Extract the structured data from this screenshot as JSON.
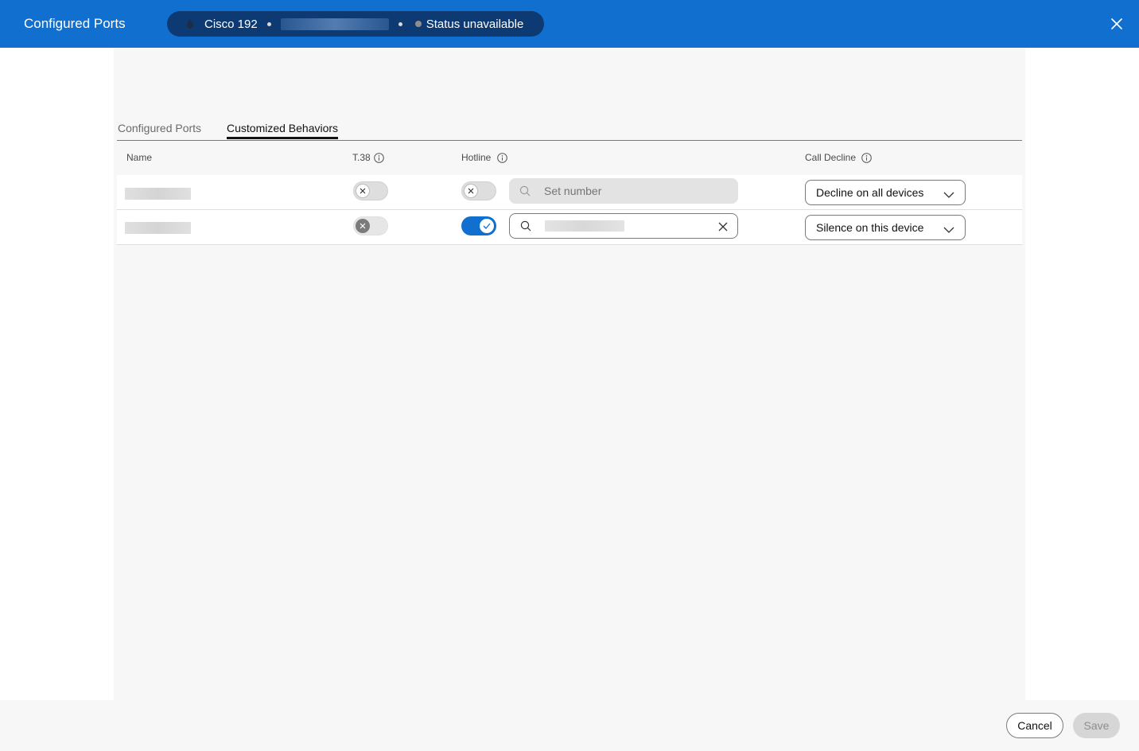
{
  "header": {
    "title": "Configured Ports",
    "device_name": "Cisco 192",
    "status": "Status unavailable"
  },
  "tabs": [
    {
      "label": "Configured Ports",
      "active": false
    },
    {
      "label": "Customized Behaviors",
      "active": true
    }
  ],
  "table": {
    "columns": {
      "name": "Name",
      "t38": "T.38",
      "hotline": "Hotline",
      "call_decline": "Call Decline"
    },
    "rows": [
      {
        "t38": "off",
        "hotline": "off",
        "hotline_placeholder": "Set number",
        "call_decline": "Decline on all devices"
      },
      {
        "t38": "disabled",
        "hotline": "on",
        "hotline_placeholder": "",
        "call_decline": "Silence on this device"
      }
    ]
  },
  "footer": {
    "cancel_label": "Cancel",
    "save_label": "Save"
  },
  "colors": {
    "header_bg": "#1170cf",
    "pill_bg": "#0d3a73",
    "toggle_on": "#1170cf"
  }
}
